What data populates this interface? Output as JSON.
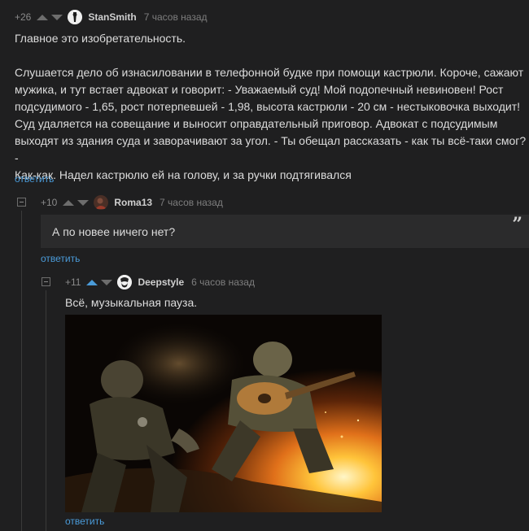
{
  "comments": [
    {
      "rating": "+26",
      "author": "StanSmith",
      "time": "7 часов назад",
      "text": [
        "Главное это изобретательность.",
        "",
        "Слушается дело об изнасиловании в телефонной будке при помощи кастрюли. Короче, сажают",
        "мужика, и тут встает адвокат и говорит: - Уважаемый суд! Мой подопечный невиновен! Рост",
        "подсудимого - 1,65, рост потерпевшей - 1,98, высота кастрюли - 20 см - нестыковочка выходит!",
        "Суд удаляется на совещание и выносит оправдательный приговор. Адвокат с подсудимым",
        "выходят из здания суда и заворачивают за угол. - Ты обещал рассказать - как ты всё-таки смог? -",
        "Как-как. Надел кастрюлю ей на голову, и за ручки подтягивался"
      ],
      "reply_label": "ответить"
    },
    {
      "rating": "+10",
      "author": "Roma13",
      "time": "7 часов назад",
      "quote_text": "А по новее ничего нет?",
      "quote_icon": "quote-icon",
      "reply_label": "ответить"
    },
    {
      "rating": "+11",
      "author": "Deepstyle",
      "time": "6 часов назад",
      "text": [
        "Всё, музыкальная пауза."
      ],
      "reply_label": "ответить"
    }
  ],
  "colors": {
    "background": "#1f1f20",
    "link": "#4a9bd9",
    "upvote_active": "#4a9bd9",
    "quote_bg": "#2b2b2c"
  }
}
